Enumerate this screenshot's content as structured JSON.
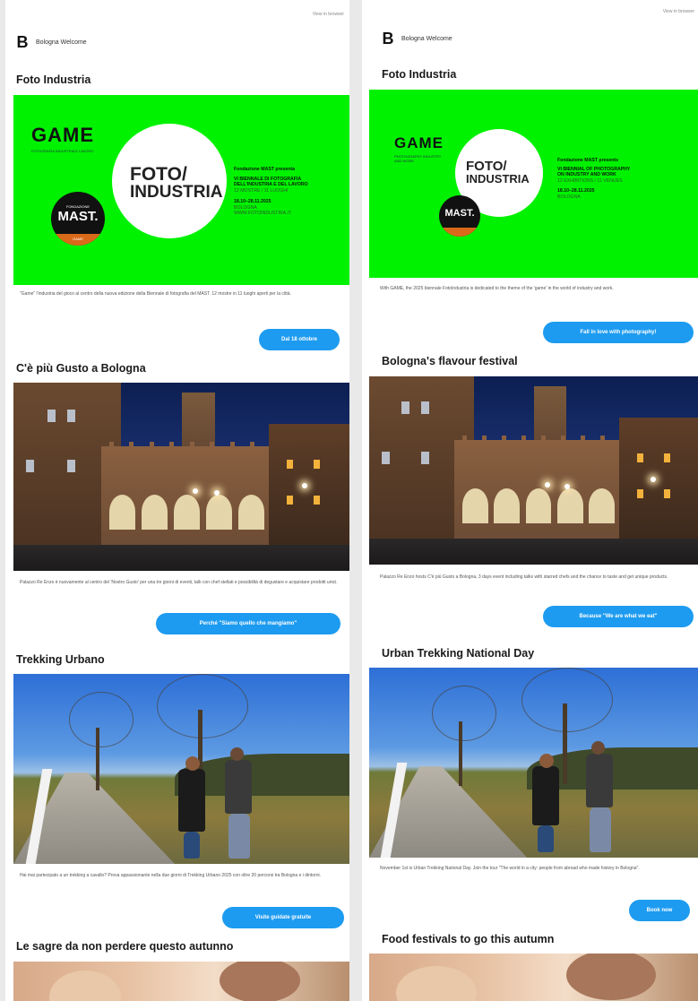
{
  "left": {
    "view_in_browser": "View in browser",
    "brand": "Bologna Welcome",
    "sections": [
      {
        "title": "Foto Industria",
        "hero": {
          "game": "GAME",
          "game_sub": "FOTOGRAFIA INDUSTRIA E LAVORO",
          "foto": "FOTO/",
          "industria": "INDUSTRIA",
          "mast": "MAST.",
          "mast_sub": "FONDAZIONE",
          "mast_ring": "GAME",
          "line1": "Fondazione MAST presenta",
          "line2": "VI BIENNALE DI FOTOGRAFIA",
          "line3": "DELL'INDUSTRIA E DEL LAVORO",
          "line4": "12 MOSTRE / 11 LUOGHI",
          "dates": "18.10–28.11.2025",
          "city": "BOLOGNA",
          "site": "WWW.FOTOINDUSTRIA.IT"
        },
        "text": "\"Game\" l'industria del gioco al centro della nuova edizione della Biennale di fotografia del MAST. 12 mostre in 11 luoghi aperti per la città.",
        "button": "Dal 18 ottobre"
      },
      {
        "title": "C'è più Gusto a Bologna",
        "text": "Palazzo Re Enzo è nuovamente al centro del 'Nostro Gusto' per una tre giorni di eventi, talk con chef stellati e possibilità di degustare e acquistare prodotti unici.",
        "button": "Perché \"Siamo quello che mangiamo\""
      },
      {
        "title": "Trekking Urbano",
        "text": "Hai mai partecipato a un trekking a cavallo? Prova appassionante nella due giorni di Trekking Urbano 2025 con oltre 20 percorsi tra Bologna e i dintorni.",
        "button": "Visite guidate gratuite"
      },
      {
        "title": "Le sagre da non perdere questo autunno"
      }
    ]
  },
  "right": {
    "view_in_browser": "View in browser",
    "brand": "Bologna Welcome",
    "sections": [
      {
        "title": "Foto Industria",
        "hero": {
          "game": "GAME",
          "game_sub": "PHOTOGRAPHY INDUSTRY AND WORK",
          "foto": "FOTO/",
          "industria": "INDUSTRIA",
          "mast": "MAST.",
          "line1": "Fondazione MAST presents",
          "line2": "VI BIENNIAL OF PHOTOGRAPHY",
          "line3": "ON INDUSTRY AND WORK",
          "line4": "12 EXHIBITIONS / 11 VENUES",
          "dates": "18.10–28.11.2025",
          "city": "BOLOGNA"
        },
        "text": "With GAME, the 2025 biennale FotoIndustria is dedicated to the theme of the 'game' in the world of industry and work.",
        "button": "Fall in love with photography!"
      },
      {
        "title": "Bologna's flavour festival",
        "text": "Palazzo Re Enzo hosts C'è più Gusto a Bologna, 3 days event including talks with starred chefs and the chance to taste and get unique products.",
        "button": "Because \"We are what we eat\""
      },
      {
        "title": "Urban Trekking National Day",
        "text": "November 1st is Urban Trekking National Day. Join the tour \"The world in a city: people from abroad who made history in Bologna\".",
        "button": "Book now"
      },
      {
        "title": "Food festivals to go this autumn"
      }
    ]
  }
}
